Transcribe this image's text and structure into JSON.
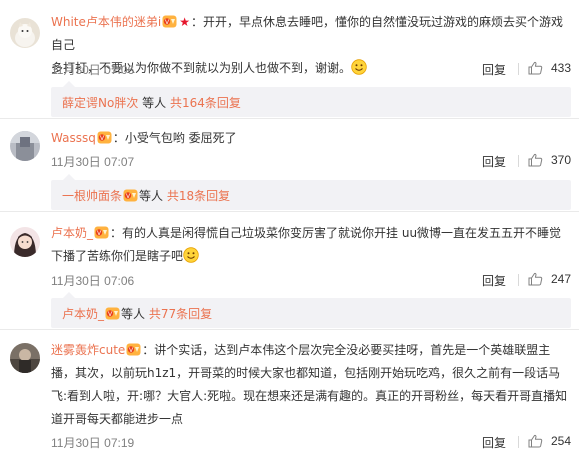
{
  "comments": [
    {
      "username": "White卢本伟的迷弟i",
      "text_part1": "：开开，早点休息去睡吧，懂你的自然懂没玩过游戏的麻烦去买个游戏自己",
      "text_part2": "多打打，不要以为你做不到就以为别人也做不到，谢谢。",
      "time": "11月30日 07:06",
      "reply_label": "回复",
      "likes": "433",
      "sub_user": "薛定谔No胖次",
      "sub_mid": "等人",
      "sub_count": "共164条回复"
    },
    {
      "username": "Wasssq",
      "text": "：小受气包哟 委屈死了",
      "time": "11月30日 07:07",
      "reply_label": "回复",
      "likes": "370",
      "sub_user": "一根帅面条",
      "sub_mid": "等人",
      "sub_count": "共18条回复"
    },
    {
      "username": "卢本奶_",
      "text_part1": "：有的人真是闲得慌自己垃圾菜你变厉害了就说你开挂 uu微博一直在发五五开不睡觉",
      "text_part2": "下播了苦练你们是瞎子吧",
      "time": "11月30日 07:06",
      "reply_label": "回复",
      "likes": "247",
      "sub_user": "卢本奶_",
      "sub_mid": "等人",
      "sub_count": "共77条回复"
    },
    {
      "username": "迷雾轰炸cute",
      "text_part1": "：讲个实话，达到卢本伟这个层次完全没必要买挂呀，首先是一个英雄联盟主",
      "text_part2": "播，其次，以前玩h1z1，开哥菜的时候大家也都知道，包括刚开始玩吃鸡，很久之前有一段话马",
      "text_part3": "飞:看到人啦，开:哪？大官人:死啦。现在想来还是满有趣的。真正的开哥粉丝，每天看开哥直播知",
      "text_part4": "道开哥每天都能进步一点",
      "time": "11月30日 07:19",
      "reply_label": "回复",
      "likes": "254"
    }
  ],
  "colors": {
    "accent": "#eb7350",
    "subbox_bg": "#f2f2f5",
    "meta": "#808080"
  },
  "icons": [
    "vip-badge-icon",
    "star-icon",
    "smile-emoji-icon",
    "thumbs-up-icon"
  ]
}
